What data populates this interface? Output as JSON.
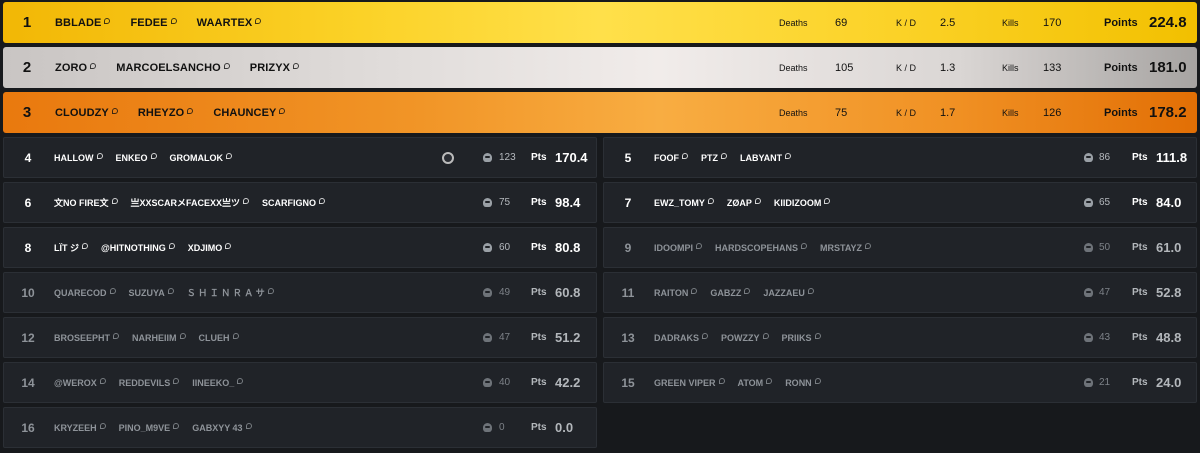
{
  "labels": {
    "deaths": "Deaths",
    "kd": "K / D",
    "kills": "Kills",
    "points": "Points",
    "pts": "Pts"
  },
  "colors": {
    "gold": "#fbd227",
    "silver": "#e2dedc",
    "bronze": "#f19527",
    "card_bg": "#202328",
    "page_bg": "#17191c"
  },
  "icons": {
    "player_tag": "tag-icon",
    "kills": "skull-icon",
    "badge": "badge-icon"
  },
  "podium": [
    {
      "rank": "1",
      "players": [
        "BBLADE",
        "FEDEE",
        "WAARTEX"
      ],
      "deaths": "69",
      "kd": "2.5",
      "kills": "170",
      "points": "224.8"
    },
    {
      "rank": "2",
      "players": [
        "ZORO",
        "MARCOELSANCHO",
        "PRIZYX"
      ],
      "deaths": "105",
      "kd": "1.3",
      "kills": "133",
      "points": "181.0"
    },
    {
      "rank": "3",
      "players": [
        "CLOUDZY",
        "RHEYZO",
        "CHAUNCEY"
      ],
      "deaths": "75",
      "kd": "1.7",
      "kills": "126",
      "points": "178.2"
    }
  ],
  "teams": [
    {
      "rank": "4",
      "players": [
        "HALLOW",
        "ENKEO",
        "GROMALOK"
      ],
      "kills": "123",
      "points": "170.4",
      "badge": true
    },
    {
      "rank": "5",
      "players": [
        "FOOF",
        "PTZ",
        "LABYANT"
      ],
      "kills": "86",
      "points": "111.8"
    },
    {
      "rank": "6",
      "players": [
        "文NO FIRE文",
        "亗XXSCARメFACEXX亗ツ",
        "SCARFIGNO"
      ],
      "kills": "75",
      "points": "98.4"
    },
    {
      "rank": "7",
      "players": [
        "EWZ_TOMY",
        "ZØAP",
        "KIIDIZOOM"
      ],
      "kills": "65",
      "points": "84.0"
    },
    {
      "rank": "8",
      "players": [
        "LÏT ジ",
        "@HITNOTHING",
        "XDJIMO"
      ],
      "kills": "60",
      "points": "80.8"
    },
    {
      "rank": "9",
      "players": [
        "IDOOMPI",
        "HARDSCOPEHANS",
        "MRSTAYZ"
      ],
      "kills": "50",
      "points": "61.0"
    },
    {
      "rank": "10",
      "players": [
        "QUARECOD",
        "SUZUYA",
        "Ｓ Ｈ Ｉ Ｎ Ｒ Ａ サ"
      ],
      "kills": "49",
      "points": "60.8"
    },
    {
      "rank": "11",
      "players": [
        "RAITON",
        "GABZZ",
        "JAZZAEU"
      ],
      "kills": "47",
      "points": "52.8"
    },
    {
      "rank": "12",
      "players": [
        "BROSEEPHT",
        "NARHEIIM",
        "CLUEH"
      ],
      "kills": "47",
      "points": "51.2"
    },
    {
      "rank": "13",
      "players": [
        "DADRAKS",
        "POWZZY",
        "PRIIKS"
      ],
      "kills": "43",
      "points": "48.8"
    },
    {
      "rank": "14",
      "players": [
        "@WEROX",
        "REDDEVILS",
        "IINEEKO_"
      ],
      "kills": "40",
      "points": "42.2"
    },
    {
      "rank": "15",
      "players": [
        "GREEN VIPER",
        "ATOM",
        "RONN"
      ],
      "kills": "21",
      "points": "24.0"
    },
    {
      "rank": "16",
      "players": [
        "KRYZEEH",
        "PINO_M9VE",
        "GABXYY 43"
      ],
      "kills": "0",
      "points": "0.0"
    }
  ]
}
